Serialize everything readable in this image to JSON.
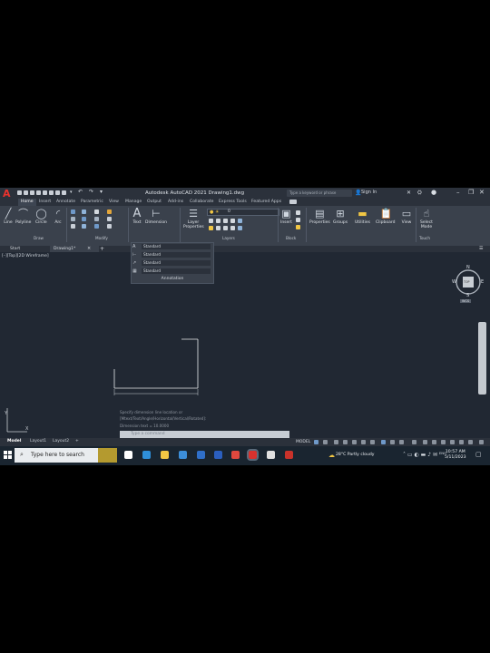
{
  "window": {
    "title": "Autodesk AutoCAD 2021   Drawing1.dwg",
    "search_placeholder": "Type a keyword or phrase",
    "sign_in": "Sign In",
    "minimize": "–",
    "restore": "❐",
    "close": "✕"
  },
  "ribbon_tabs": [
    "Home",
    "Insert",
    "Annotate",
    "Parametric",
    "View",
    "Manage",
    "Output",
    "Add-ins",
    "Collaborate",
    "Express Tools",
    "Featured Apps"
  ],
  "ribbon": {
    "draw_tools": [
      "Line",
      "Polyline",
      "Circle",
      "Arc"
    ],
    "draw_group": "Draw",
    "modify_group": "Modify",
    "text_label": "Text",
    "dimension_label": "Dimension",
    "layer_properties": "Layer Properties",
    "layers_group": "Layers",
    "insert_label": "Insert",
    "block_group": "Block",
    "properties_label": "Properties",
    "groups_label": "Groups",
    "utilities_label": "Utilities",
    "clipboard_label": "Clipboard",
    "view_label": "View",
    "select_mode_label": "Select Mode",
    "touch_group": "Touch",
    "layer_value": "0"
  },
  "file_tabs": {
    "start": "Start",
    "drawing": "Drawing1*",
    "close": "×",
    "add": "+"
  },
  "viewport_label": "[–][Top][2D Wireframe]",
  "annotation_panel": {
    "styles": [
      "Standard",
      "Standard",
      "Standard",
      "Standard"
    ],
    "footer": "Annotation"
  },
  "viewcube": {
    "n": "N",
    "s": "S",
    "e": "E",
    "w": "W",
    "face": "TOP",
    "wcs": "WCS"
  },
  "command": {
    "history": [
      "Specify dimension line location or",
      "[Mtext/Text/Angle/Horizontal/Vertical/Rotated]:",
      "Dimension text = 10.0000"
    ],
    "placeholder": "Type a command"
  },
  "layout_tabs": [
    "Model",
    "Layout1",
    "Layout2"
  ],
  "add_layout": "+",
  "status": {
    "model": "MODEL"
  },
  "taskbar": {
    "search_placeholder": "Type here to search",
    "weather": "28°C  Partly cloudy",
    "time": "10:57 AM",
    "date": "5/11/2023"
  },
  "colors": {
    "canvas": "#212833",
    "ribbon": "#3a414c",
    "accent": "#e8332e"
  }
}
